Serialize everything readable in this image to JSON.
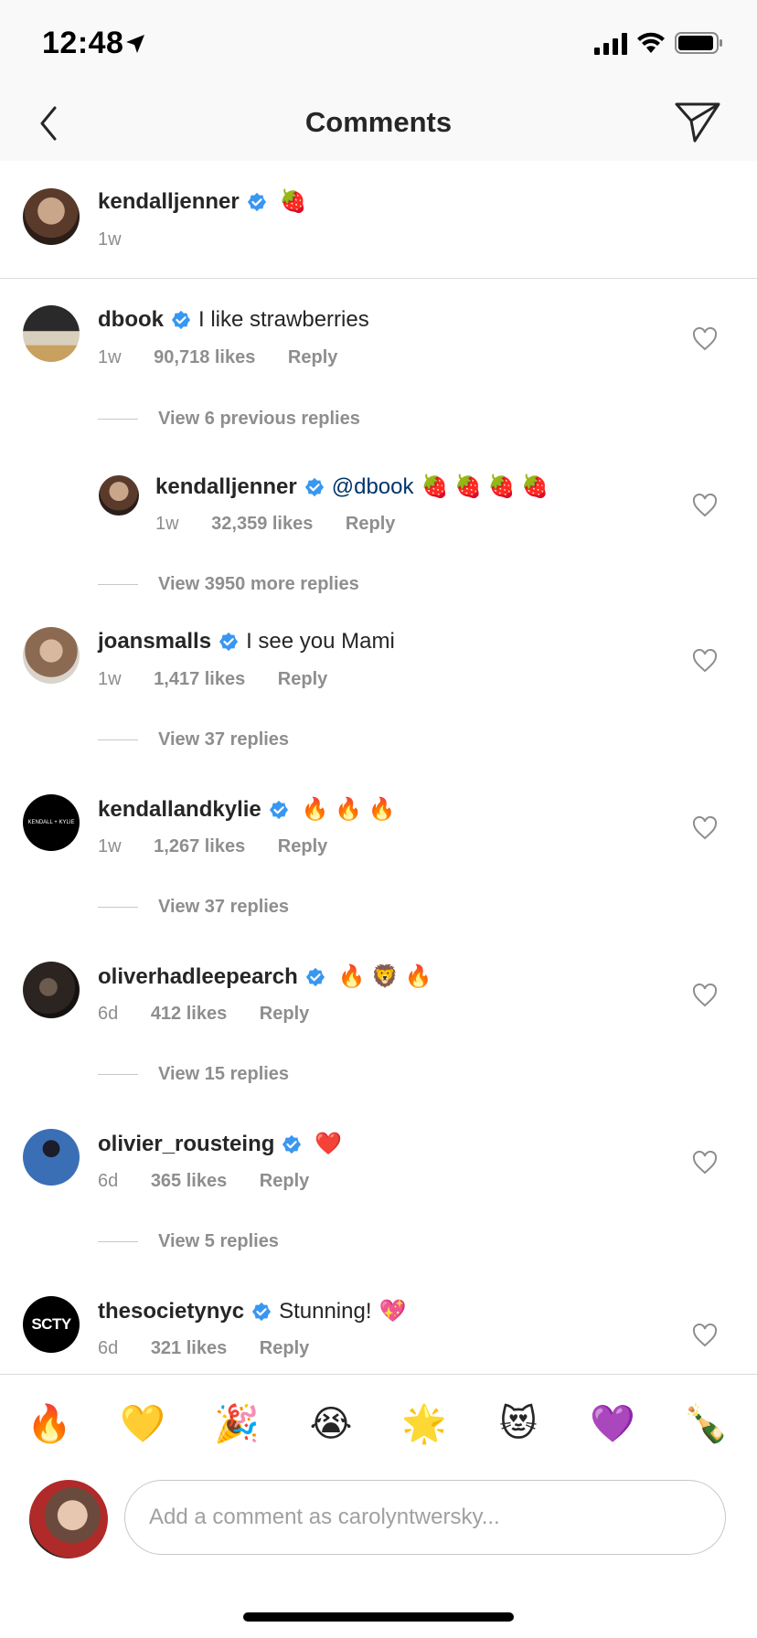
{
  "status": {
    "time": "12:48"
  },
  "header": {
    "title": "Comments",
    "back_icon": "chevron-left-icon",
    "send_icon": "paper-plane-icon"
  },
  "caption": {
    "username": "kendalljenner",
    "verified": true,
    "emoji": "🍓",
    "time": "1w"
  },
  "comments": [
    {
      "username": "dbook",
      "text": "I like strawberries",
      "emoji": "",
      "time": "1w",
      "likes": "90,718 likes",
      "reply": "Reply",
      "view_replies": "View 6 previous replies"
    },
    {
      "username": "kendalljenner",
      "mention": "@dbook",
      "emoji": "🍓 🍓 🍓 🍓",
      "time": "1w",
      "likes": "32,359 likes",
      "reply": "Reply",
      "view_replies": "View 3950 more replies"
    },
    {
      "username": "joansmalls",
      "text": "I see you Mami",
      "emoji": "",
      "time": "1w",
      "likes": "1,417 likes",
      "reply": "Reply",
      "view_replies": "View 37 replies"
    },
    {
      "username": "kendallandkylie",
      "text": "",
      "emoji": "🔥 🔥 🔥",
      "time": "1w",
      "likes": "1,267 likes",
      "reply": "Reply",
      "view_replies": "View 37 replies",
      "avatar_text": "KENDALL + KYLIE"
    },
    {
      "username": "oliverhadleepearch",
      "text": "",
      "emoji": "🔥 🦁 🔥",
      "time": "6d",
      "likes": "412 likes",
      "reply": "Reply",
      "view_replies": "View 15 replies"
    },
    {
      "username": "olivier_rousteing",
      "text": "",
      "emoji": "❤️",
      "time": "6d",
      "likes": "365 likes",
      "reply": "Reply",
      "view_replies": "View 5 replies"
    },
    {
      "username": "thesocietynyc",
      "text": "Stunning!",
      "emoji": "💖",
      "time": "6d",
      "likes": "321 likes",
      "reply": "Reply",
      "avatar_text": "SCTY"
    }
  ],
  "quick_emojis": [
    "🔥",
    "💛",
    "🎉",
    "😭",
    "🌟",
    "😻",
    "💜",
    "🍾"
  ],
  "composer": {
    "placeholder": "Add a comment as carolyntwersky..."
  },
  "colors": {
    "verified": "#3897f0",
    "meta": "#8e8e8e",
    "mention": "#003569"
  }
}
